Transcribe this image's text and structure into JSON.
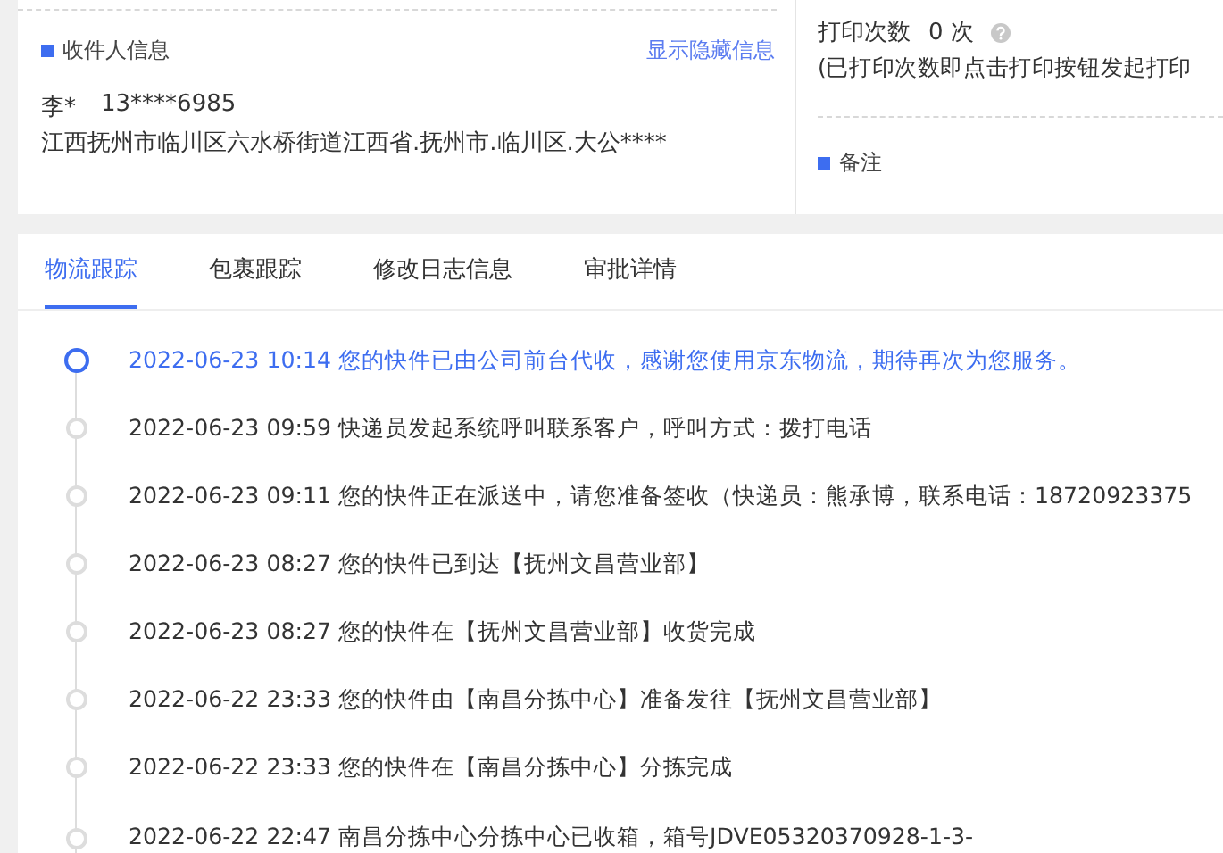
{
  "recipient": {
    "title": "收件人信息",
    "toggle_link": "显示隐藏信息",
    "name": "李*",
    "phone": "13****6985",
    "address": "江西抚州市临川区六水桥街道江西省.抚州市.临川区.大公****"
  },
  "print": {
    "label": "打印次数",
    "count": "0 次",
    "note": "(已打印次数即点击打印按钮发起打印"
  },
  "remarks": {
    "title": "备注"
  },
  "tabs": [
    {
      "label": "物流跟踪",
      "selected": true
    },
    {
      "label": "包裹跟踪",
      "selected": false
    },
    {
      "label": "修改日志信息",
      "selected": false
    },
    {
      "label": "审批详情",
      "selected": false
    }
  ],
  "timeline": [
    {
      "time": "2022-06-23 10:14",
      "text": "您的快件已由公司前台代收，感谢您使用京东物流，期待再次为您服务。",
      "selected": true
    },
    {
      "time": "2022-06-23 09:59",
      "text": "快递员发起系统呼叫联系客户，呼叫方式：拨打电话",
      "selected": false
    },
    {
      "time": "2022-06-23 09:11",
      "text": "您的快件正在派送中，请您准备签收（快递员：熊承博，联系电话：18720923375",
      "selected": false
    },
    {
      "time": "2022-06-23 08:27",
      "text": "您的快件已到达【抚州文昌营业部】",
      "selected": false
    },
    {
      "time": "2022-06-23 08:27",
      "text": "您的快件在【抚州文昌营业部】收货完成",
      "selected": false
    },
    {
      "time": "2022-06-22 23:33",
      "text": "您的快件由【南昌分拣中心】准备发往【抚州文昌营业部】",
      "selected": false
    },
    {
      "time": "2022-06-22 23:33",
      "text": "您的快件在【南昌分拣中心】分拣完成",
      "selected": false
    },
    {
      "time": "2022-06-22 22:47",
      "text": "南昌分拣中心分拣中心已收箱，箱号JDVE05320370928-1-3-",
      "selected": false
    }
  ]
}
